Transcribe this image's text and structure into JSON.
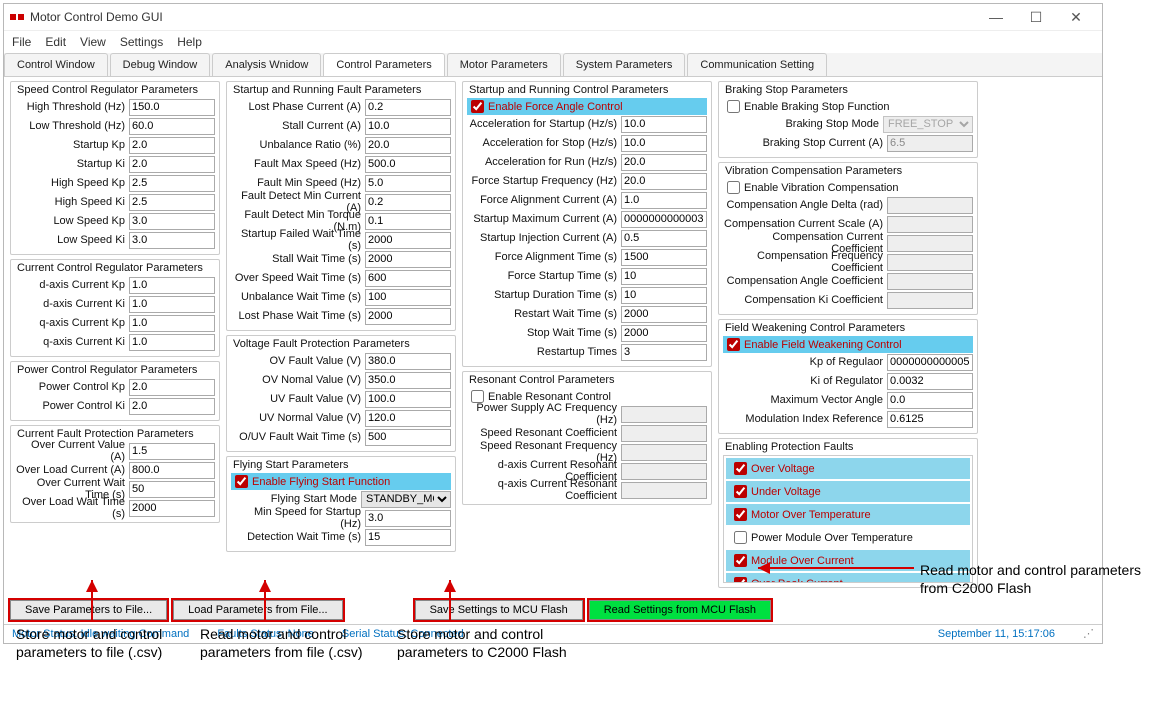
{
  "window": {
    "title": "Motor Control Demo GUI"
  },
  "menu": {
    "file": "File",
    "edit": "Edit",
    "view": "View",
    "settings": "Settings",
    "help": "Help"
  },
  "tabs": {
    "cw": "Control Window",
    "dw": "Debug Window",
    "aw": "Analysis Wnidow",
    "cp": "Control Parameters",
    "mp": "Motor Parameters",
    "sp": "System Parameters",
    "cs": "Communication Setting"
  },
  "speedCtrl": {
    "title": "Speed Control Regulator Parameters",
    "highThr": {
      "lbl": "High Threshold (Hz)",
      "val": "150.0"
    },
    "lowThr": {
      "lbl": "Low Threshold (Hz)",
      "val": "60.0"
    },
    "startupKp": {
      "lbl": "Startup Kp",
      "val": "2.0"
    },
    "startupKi": {
      "lbl": "Startup Ki",
      "val": "2.0"
    },
    "hsKp": {
      "lbl": "High Speed Kp",
      "val": "2.5"
    },
    "hsKi": {
      "lbl": "High Speed Ki",
      "val": "2.5"
    },
    "lsKp": {
      "lbl": "Low Speed Kp",
      "val": "3.0"
    },
    "lsKi": {
      "lbl": "Low Speed Ki",
      "val": "3.0"
    }
  },
  "currCtrl": {
    "title": "Current Control Regulator Parameters",
    "dKp": {
      "lbl": "d-axis Current Kp",
      "val": "1.0"
    },
    "dKi": {
      "lbl": "d-axis Current Ki",
      "val": "1.0"
    },
    "qKp": {
      "lbl": "q-axis Current Kp",
      "val": "1.0"
    },
    "qKi": {
      "lbl": "q-axis Current Ki",
      "val": "1.0"
    }
  },
  "pwrCtrl": {
    "title": "Power Control Regulator Parameters",
    "pKp": {
      "lbl": "Power Control Kp",
      "val": "2.0"
    },
    "pKi": {
      "lbl": "Power Control Ki",
      "val": "2.0"
    }
  },
  "currFault": {
    "title": "Current Fault Protection Parameters",
    "ocVal": {
      "lbl": "Over Current Value (A)",
      "val": "1.5"
    },
    "olCurr": {
      "lbl": "Over Load Current (A)",
      "val": "800.0"
    },
    "ocWait": {
      "lbl": "Over Current Wait Time (s)",
      "val": "50"
    },
    "olWait": {
      "lbl": "Over Load Wait Time (s)",
      "val": "2000"
    }
  },
  "srFault": {
    "title": "Startup and Running Fault Parameters",
    "lostPhase": {
      "lbl": "Lost Phase Current (A)",
      "val": "0.2"
    },
    "stallCurr": {
      "lbl": "Stall Current (A)",
      "val": "10.0"
    },
    "unbRatio": {
      "lbl": "Unbalance Ratio (%)",
      "val": "20.0"
    },
    "fMaxSpd": {
      "lbl": "Fault Max Speed (Hz)",
      "val": "500.0"
    },
    "fMinSpd": {
      "lbl": "Fault Min Speed (Hz)",
      "val": "5.0"
    },
    "fdMinCurr": {
      "lbl": "Fault Detect Min Current (A)",
      "val": "0.2"
    },
    "fdMinTrq": {
      "lbl": "Fault Detect Min Torque (N.m)",
      "val": "0.1"
    },
    "sfWait": {
      "lbl": "Startup Failed Wait Time (s)",
      "val": "2000"
    },
    "stallWait": {
      "lbl": "Stall Wait Time (s)",
      "val": "2000"
    },
    "osWait": {
      "lbl": "Over Speed Wait Time (s)",
      "val": "600"
    },
    "unbWait": {
      "lbl": "Unbalance Wait Time (s)",
      "val": "100"
    },
    "lpWait": {
      "lbl": "Lost Phase Wait Time (s)",
      "val": "2000"
    }
  },
  "voltFault": {
    "title": "Voltage Fault Protection Parameters",
    "ovFault": {
      "lbl": "OV Fault Value (V)",
      "val": "380.0"
    },
    "ovNom": {
      "lbl": "OV Nomal Value (V)",
      "val": "350.0"
    },
    "uvFault": {
      "lbl": "UV Fault Value (V)",
      "val": "100.0"
    },
    "uvNom": {
      "lbl": "UV Normal Value (V)",
      "val": "120.0"
    },
    "ouvWait": {
      "lbl": "O/UV Fault Wait Time (s)",
      "val": "500"
    }
  },
  "flyStart": {
    "title": "Flying Start Parameters",
    "chk": "Enable Flying Start Function",
    "mode": {
      "lbl": "Flying Start Mode",
      "val": "STANDBY_MODE"
    },
    "minSpd": {
      "lbl": "Min Speed for Startup (Hz)",
      "val": "3.0"
    },
    "detWait": {
      "lbl": "Detection Wait Time (s)",
      "val": "15"
    }
  },
  "srCtrl": {
    "title": "Startup and Running Control Parameters",
    "chk": "Enable Force Angle Control",
    "accStart": {
      "lbl": "Acceleration for Startup (Hz/s)",
      "val": "10.0"
    },
    "accStop": {
      "lbl": "Acceleration for Stop (Hz/s)",
      "val": "10.0"
    },
    "accRun": {
      "lbl": "Acceleration for Run (Hz/s)",
      "val": "20.0"
    },
    "forceFreq": {
      "lbl": "Force Startup Frequency (Hz)",
      "val": "20.0"
    },
    "forceAlign": {
      "lbl": "Force Alignment Current (A)",
      "val": "1.0"
    },
    "startMax": {
      "lbl": "Startup Maximum Current (A)",
      "val": "0000000000003"
    },
    "startInj": {
      "lbl": "Startup Injection Current (A)",
      "val": "0.5"
    },
    "faTime": {
      "lbl": "Force Alignment Time (s)",
      "val": "1500"
    },
    "fsTime": {
      "lbl": "Force Startup Time (s)",
      "val": "10"
    },
    "sdTime": {
      "lbl": "Startup Duration Time (s)",
      "val": "10"
    },
    "restartWait": {
      "lbl": "Restart Wait Time (s)",
      "val": "2000"
    },
    "stopWait": {
      "lbl": "Stop Wait Time (s)",
      "val": "2000"
    },
    "restartTimes": {
      "lbl": "Restartup Times",
      "val": "3"
    }
  },
  "resCtrl": {
    "title": "Resonant Control Parameters",
    "chk": "Enable Resonant Control",
    "acFreq": {
      "lbl": "Power Supply AC Frequency (Hz)"
    },
    "spdRes": {
      "lbl": "Speed Resonant Coefficient"
    },
    "spdResFreq": {
      "lbl": "Speed Resonant Frequency (Hz)"
    },
    "dRes": {
      "lbl": "d-axis Current Resonant Coefficient"
    },
    "qRes": {
      "lbl": "q-axis Current Resonant Coefficient"
    }
  },
  "brake": {
    "title": "Braking Stop Parameters",
    "chk": "Enable Braking Stop Function",
    "mode": {
      "lbl": "Braking Stop Mode",
      "val": "FREE_STOP"
    },
    "curr": {
      "lbl": "Braking Stop Current (A)",
      "val": "6.5"
    }
  },
  "vibe": {
    "title": "Vibration Compensation Parameters",
    "chk": "Enable Vibration Compensation",
    "ang": {
      "lbl": "Compensation Angle Delta (rad)"
    },
    "currScale": {
      "lbl": "Compensation Current Scale (A)"
    },
    "currCoef": {
      "lbl": "Compensation Current Coefficient"
    },
    "freqCoef": {
      "lbl": "Compensation Frequency Coefficient"
    },
    "angCoef": {
      "lbl": "Compensation Angle Coefficient"
    },
    "kiCoef": {
      "lbl": "Compensation Ki Coefficient"
    }
  },
  "fw": {
    "title": "Field Weakening Control Parameters",
    "chk": "Enable Field Weakening Control",
    "kp": {
      "lbl": "Kp of Regulaor",
      "val": "0000000000005"
    },
    "ki": {
      "lbl": "Ki of Regulator",
      "val": "0.0032"
    },
    "mva": {
      "lbl": "Maximum Vector Angle",
      "val": "0.0"
    },
    "mir": {
      "lbl": "Modulation Index Reference",
      "val": "0.6125"
    }
  },
  "pf": {
    "title": "Enabling Protection Faults",
    "items": [
      {
        "lbl": "Over Voltage",
        "chk": true,
        "red": true
      },
      {
        "lbl": "Under Voltage",
        "chk": true,
        "red": true
      },
      {
        "lbl": "Motor Over Temperature",
        "chk": true,
        "red": true
      },
      {
        "lbl": "Power Module Over Temperature",
        "chk": false,
        "red": false
      },
      {
        "lbl": "Module Over Current",
        "chk": true,
        "red": true
      },
      {
        "lbl": "Over Peak Current",
        "chk": true,
        "red": true
      }
    ]
  },
  "buttons": {
    "save": "Save Parameters to File...",
    "load": "Load Parameters from File...",
    "saveMcu": "Save Settings to MCU Flash",
    "readMcu": "Read Settings from MCU Flash"
  },
  "status": {
    "motor": "Motor Status: Idle waiting Command",
    "fault": "Faults Status: None",
    "serial": "Serial Status: Connected",
    "time": "September 11, 15:17:06"
  },
  "callouts": {
    "c1": "Store motor and control parameters to file (.csv)",
    "c2": "Read motor and control parameters from file (.csv)",
    "c3": "Store motor and control parameters to C2000 Flash",
    "c4": "Read motor and control parameters from C2000 Flash"
  }
}
